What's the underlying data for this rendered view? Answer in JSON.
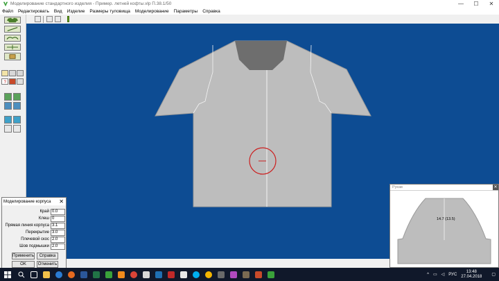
{
  "window": {
    "title": "Моделирование стандартного изделия - Пример. летней кофты.vlp     П.38.1/50",
    "controls": {
      "minimize": "—",
      "maximize": "☐",
      "close": "✕"
    }
  },
  "menu": [
    "Файл",
    "Редактировать",
    "Вид",
    "Изделие",
    "Размеры туловища",
    "Моделирование",
    "Параметры",
    "Справка"
  ],
  "colors": {
    "canvas": "#0d4c93",
    "garment": "#bdbdbd",
    "neckline": "#6e6e6e",
    "accent_green": "#6aa624",
    "marker_red": "#cc1f1f",
    "taskbar": "#10182a"
  },
  "dialog": {
    "title": "Моделирование корпуса",
    "close": "✕",
    "fields": [
      {
        "label": "Край",
        "value": "0.0"
      },
      {
        "label": "Клеш",
        "value": "0"
      },
      {
        "label": "Прямая линия корпуса",
        "value": "3.1"
      },
      {
        "label": "Перекрытие",
        "value": "3.0"
      },
      {
        "label": "Плечевой скос",
        "value": "2.0"
      },
      {
        "label": "Шов подмышки",
        "value": "2.0"
      }
    ],
    "buttons": {
      "apply": "Применить",
      "help": "Справка",
      "ok": "OK",
      "cancel": "Отменить"
    }
  },
  "preview": {
    "title": "Рукав",
    "close": "✕",
    "measure_label": "14.7  (13.5)"
  },
  "taskbar": {
    "icons": [
      "start-icon",
      "search-icon",
      "task-view-icon",
      "explorer-icon",
      "edge-icon",
      "firefox-icon",
      "word-icon",
      "excel-icon",
      "app-icon",
      "vlc-icon",
      "chrome-icon",
      "paint-icon",
      "photos-icon",
      "media-icon",
      "camera-icon",
      "skype-icon",
      "chrome-icon",
      "settings-icon",
      "app-icon",
      "gimp-icon",
      "vector-icon",
      "pattern-app-icon"
    ],
    "language": "РУС",
    "time": "13:48",
    "date": "27.04.2018"
  }
}
